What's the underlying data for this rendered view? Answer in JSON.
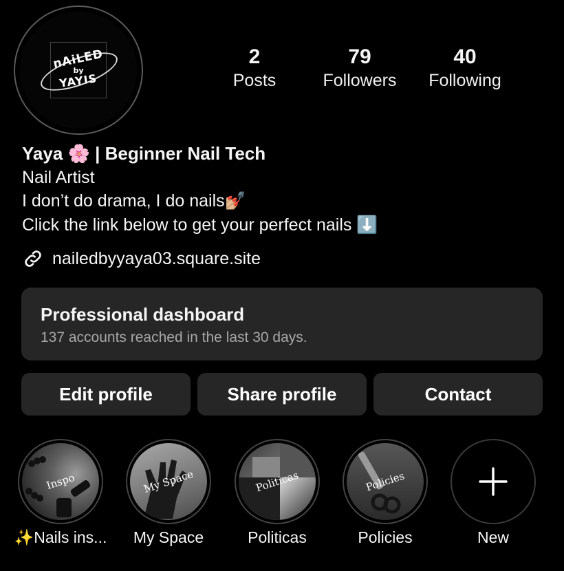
{
  "profile": {
    "logo_line1": "nAiLED",
    "logo_line2": "by",
    "logo_line3": "YAYIS"
  },
  "stats": [
    {
      "value": "2",
      "label": "Posts"
    },
    {
      "value": "79",
      "label": "Followers"
    },
    {
      "value": "40",
      "label": "Following"
    }
  ],
  "bio": {
    "name": "Yaya 🌸 | Beginner Nail Tech",
    "category": "Nail Artist",
    "line1": "I don’t do drama, I do nails💅🏼",
    "line2": "Click the link below to get your perfect nails ⬇️",
    "link": "nailedbyyaya03.square.site",
    "link_icon": "link-icon"
  },
  "dashboard": {
    "title": "Professional dashboard",
    "subtitle": "137 accounts reached in the last 30 days."
  },
  "buttons": {
    "edit": "Edit profile",
    "share": "Share profile",
    "contact": "Contact"
  },
  "highlights": [
    {
      "label": "✨Nails ins...",
      "cover_text": "Inspo"
    },
    {
      "label": "My Space",
      "cover_text": "My Space"
    },
    {
      "label": "Politicas",
      "cover_text": "Politicas"
    },
    {
      "label": "Policies",
      "cover_text": "Policies"
    },
    {
      "label": "New",
      "icon": "plus-icon"
    }
  ]
}
